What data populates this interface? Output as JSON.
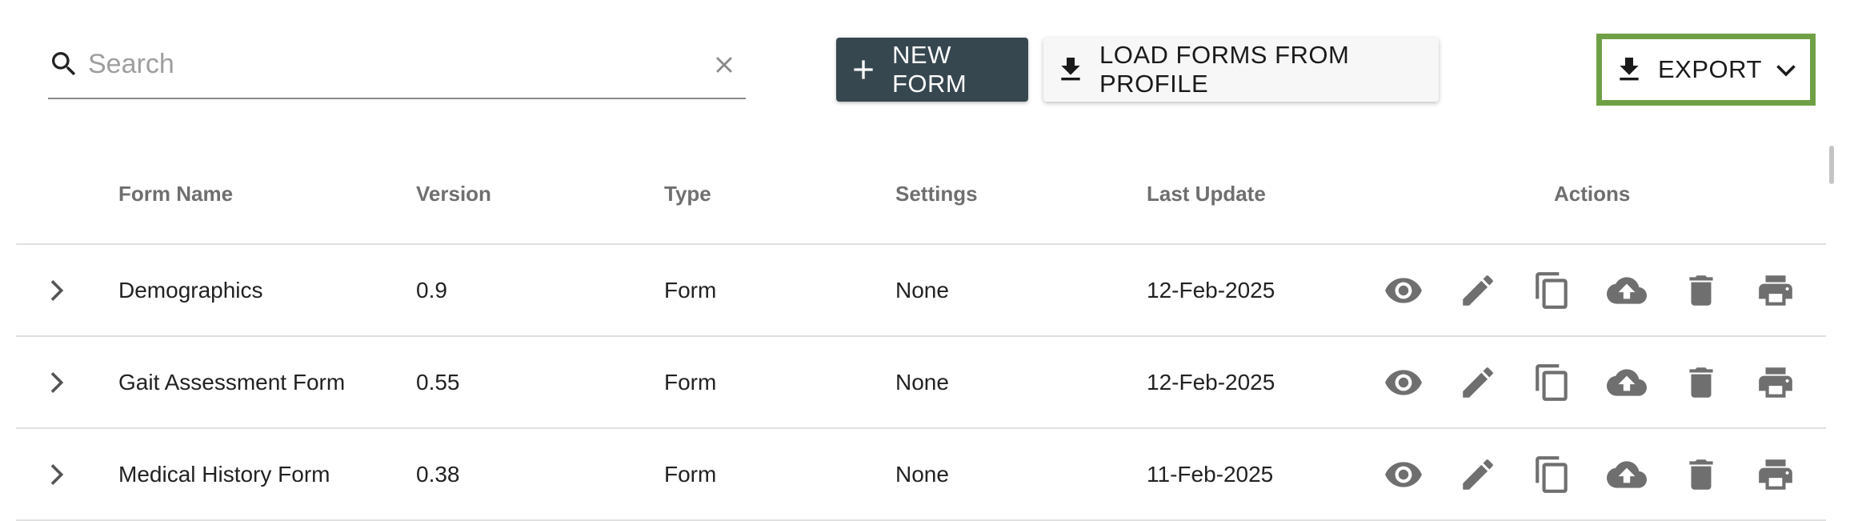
{
  "search": {
    "placeholder": "Search",
    "value": ""
  },
  "toolbar": {
    "new_form": "NEW FORM",
    "load_forms": "LOAD FORMS FROM PROFILE",
    "export": "EXPORT"
  },
  "accent_color": "#70a046",
  "dark_button_color": "#37474f",
  "table": {
    "headers": {
      "name": "Form Name",
      "version": "Version",
      "type": "Type",
      "settings": "Settings",
      "last_update": "Last Update",
      "actions": "Actions"
    },
    "rows": [
      {
        "name": "Demographics",
        "version": "0.9",
        "type": "Form",
        "settings": "None",
        "last_update": "12-Feb-2025"
      },
      {
        "name": "Gait Assessment Form",
        "version": "0.55",
        "type": "Form",
        "settings": "None",
        "last_update": "12-Feb-2025"
      },
      {
        "name": "Medical History Form",
        "version": "0.38",
        "type": "Form",
        "settings": "None",
        "last_update": "11-Feb-2025"
      }
    ],
    "row_action_icons": [
      "eye-icon",
      "pencil-icon",
      "copy-icon",
      "cloud-upload-icon",
      "trash-icon",
      "print-icon"
    ]
  }
}
